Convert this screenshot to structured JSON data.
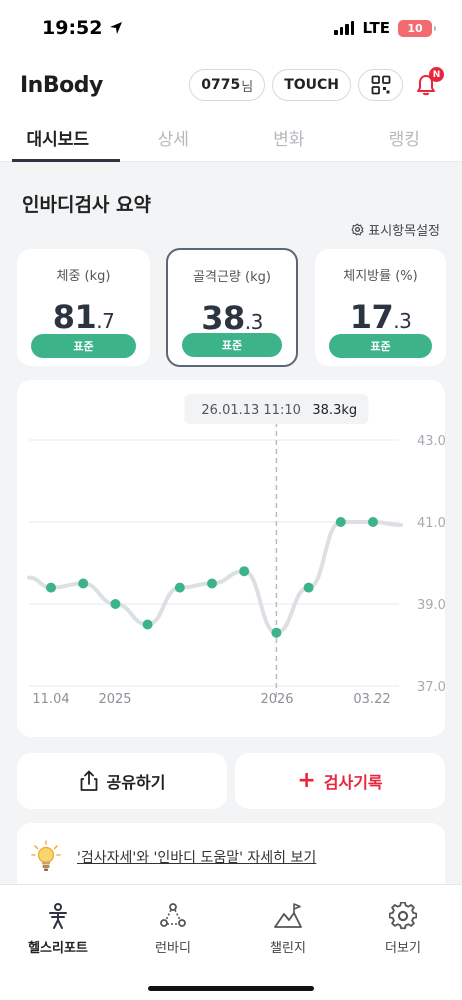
{
  "status_bar": {
    "time": "19:52",
    "network": "LTE",
    "battery": "10"
  },
  "header": {
    "logo": "InBody",
    "user_id": "0775",
    "user_suffix": "님",
    "touch_label": "TOUCH",
    "notification_badge": "N"
  },
  "tabs": [
    {
      "label": "대시보드",
      "active": true
    },
    {
      "label": "상세",
      "active": false
    },
    {
      "label": "변화",
      "active": false
    },
    {
      "label": "랭킹",
      "active": false
    }
  ],
  "summary": {
    "title": "인바디검사 요약",
    "settings_label": "표시항목설정",
    "metrics": [
      {
        "label": "체중 (kg)",
        "int": "81",
        "dec": ".7",
        "badge": "표준",
        "selected": false
      },
      {
        "label": "골격근량 (kg)",
        "int": "38",
        "dec": ".3",
        "badge": "표준",
        "selected": true
      },
      {
        "label": "체지방률 (%)",
        "int": "17",
        "dec": ".3",
        "badge": "표준",
        "selected": false
      }
    ]
  },
  "chart_data": {
    "type": "line",
    "tooltip": {
      "date": "26.01.13 11:10",
      "value": "38.3kg"
    },
    "x_tick_labels": [
      "11.04",
      "2025",
      "2026",
      "03.22"
    ],
    "y_tick_labels": [
      "43.0",
      "41.0",
      "39.0",
      "37.0"
    ],
    "ylim": [
      37.0,
      43.0
    ],
    "series": [
      {
        "values": [
          39.4,
          39.5,
          39.0,
          38.5,
          39.4,
          39.5,
          39.8,
          38.3,
          39.4,
          41.0,
          41.0
        ]
      }
    ],
    "selected_index": 7,
    "line_color": "#dcdfe3",
    "point_color": "#3db38a",
    "grid": true
  },
  "actions": {
    "share_label": "공유하기",
    "record_label": "검사기록"
  },
  "guide": {
    "text": "'검사자세'와 '인바디 도움말' 자세히 보기"
  },
  "bottom_nav": [
    {
      "label": "헬스리포트",
      "icon": "health-report-icon",
      "active": true
    },
    {
      "label": "런바디",
      "icon": "runbody-icon",
      "active": false
    },
    {
      "label": "챌린지",
      "icon": "challenge-flag-icon",
      "active": false
    },
    {
      "label": "더보기",
      "icon": "gear-icon",
      "active": false
    }
  ],
  "colors": {
    "accent_green": "#3db38a",
    "accent_red": "#e8263e",
    "dark": "#2b3440"
  }
}
